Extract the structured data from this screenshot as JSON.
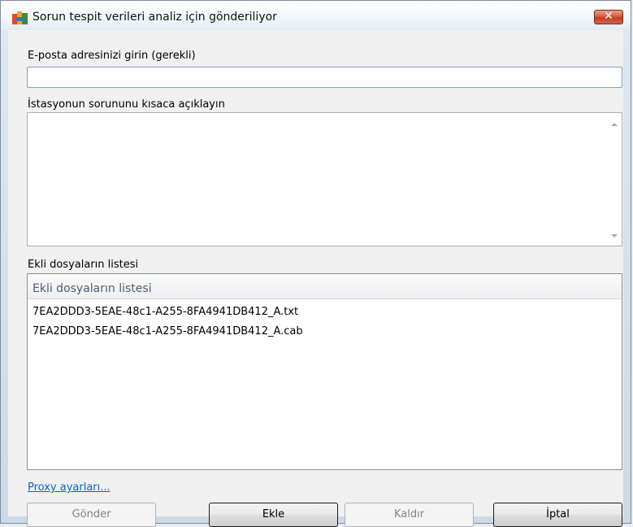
{
  "window": {
    "title": "Sorun tespit verileri analiz için gönderiliyor",
    "close_label": "✕"
  },
  "form": {
    "email_label": "E-posta adresinizi girin (gerekli)",
    "email_value": "",
    "description_label": "İstasyonun sorununu kısaca açıklayın",
    "description_value": ""
  },
  "attachments": {
    "label": "Ekli dosyaların listesi",
    "column_header": "Ekli dosyaların listesi",
    "files": [
      "7EA2DDD3-5EAE-48c1-A255-8FA4941DB412_A.txt",
      "7EA2DDD3-5EAE-48c1-A255-8FA4941DB412_A.cab"
    ]
  },
  "proxy_link": "Proxy ayarları...",
  "buttons": {
    "send": "Gönder",
    "add": "Ekle",
    "remove": "Kaldır",
    "cancel": "İptal"
  },
  "icons": {
    "app": "avg-logo-icon",
    "close": "close-icon",
    "scroll_up": "scroll-up-arrow-icon",
    "scroll_down": "scroll-down-arrow-icon"
  }
}
